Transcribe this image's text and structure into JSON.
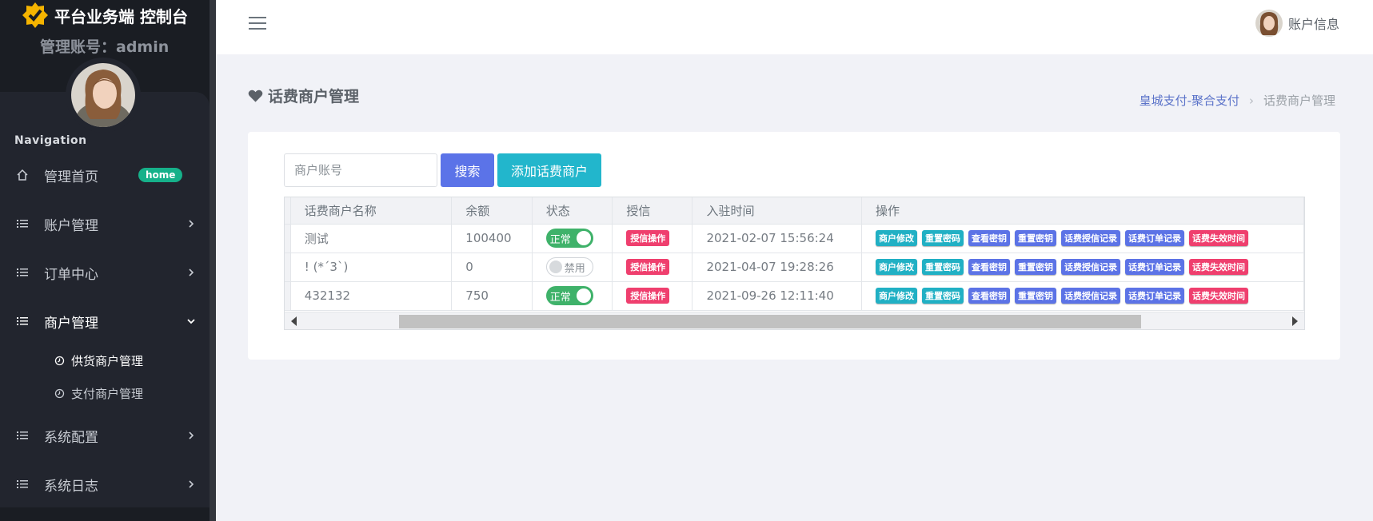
{
  "brand": {
    "title": "平台业务端 控制台",
    "admin_line": "管理账号：admin"
  },
  "nav": {
    "heading": "Navigation",
    "items": [
      {
        "label": "管理首页",
        "badge": "home"
      },
      {
        "label": "账户管理"
      },
      {
        "label": "订单中心"
      },
      {
        "label": "商户管理"
      },
      {
        "label": "系统配置"
      },
      {
        "label": "系统日志"
      }
    ],
    "sub_items": [
      {
        "label": "供货商户管理"
      },
      {
        "label": "支付商户管理"
      }
    ]
  },
  "topbar": {
    "account_label": "账户信息"
  },
  "page": {
    "title": "话费商户管理"
  },
  "breadcrumb": {
    "link": "皇城支付-聚合支付",
    "current": "话费商户管理"
  },
  "search": {
    "placeholder": "商户账号",
    "search_label": "搜索",
    "add_label": "添加话费商户"
  },
  "table": {
    "columns": [
      "话费商户名称",
      "余额",
      "状态",
      "授信",
      "入驻时间",
      "操作"
    ],
    "rows": [
      {
        "name": "测试",
        "balance": "100400",
        "status": "正常",
        "credit": "授信操作",
        "time": "2021-02-07 15:56:24"
      },
      {
        "name": "! (*´3`)",
        "balance": "0",
        "status": "禁用",
        "credit": "授信操作",
        "time": "2021-04-07 19:28:26"
      },
      {
        "name": "432132",
        "balance": "750",
        "status": "正常",
        "credit": "授信操作",
        "time": "2021-09-26 12:11:40"
      }
    ],
    "actions": [
      "商户修改",
      "重置密码",
      "查看密钥",
      "重置密钥",
      "话费授信记录",
      "话费订单记录",
      "话费失效时间"
    ]
  },
  "colors": {
    "primary": "#5b73e8",
    "info": "#22b6cc",
    "success": "#3fb26a",
    "danger": "#ef3f6e",
    "sidebar": "#1a1d23"
  }
}
